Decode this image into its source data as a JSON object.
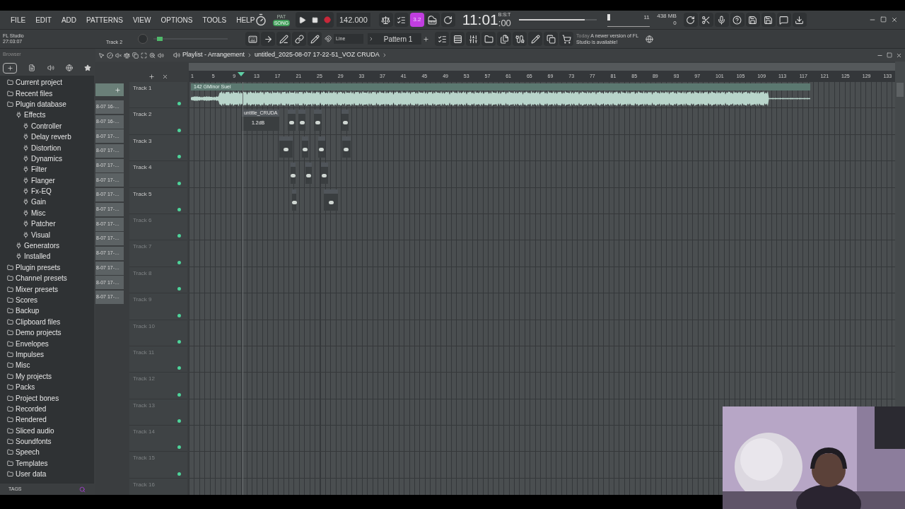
{
  "menu": [
    "FILE",
    "EDIT",
    "ADD",
    "PATTERNS",
    "VIEW",
    "OPTIONS",
    "TOOLS",
    "HELP"
  ],
  "transport": {
    "modes": [
      {
        "label": "PAT",
        "selected": false
      },
      {
        "label": "SONG",
        "selected": true
      }
    ],
    "tempo": "142.000",
    "step": "3.2"
  },
  "clock": {
    "time": "11:01",
    "sub": ":00",
    "unit": "B:S:T"
  },
  "master_volume": {
    "level": 0.85
  },
  "pitch": {
    "level": 0.05
  },
  "monitor": {
    "voices": "11",
    "memory": "438 MB",
    "cpu": "0"
  },
  "hint": {
    "app": "FL Studio",
    "time": "27:03:07",
    "target": "Track 2"
  },
  "snap": "Line",
  "pattern": "Pattern 1",
  "news": {
    "when": "Today",
    "text": "A newer version of FL Studio is available!"
  },
  "browser": {
    "title": "Browser",
    "footer": "TAGS",
    "items": [
      {
        "label": "Current project"
      },
      {
        "label": "Recent files"
      },
      {
        "label": "Plugin database",
        "children": [
          {
            "label": "Effects",
            "children": [
              {
                "label": "Controller"
              },
              {
                "label": "Delay reverb"
              },
              {
                "label": "Distortion"
              },
              {
                "label": "Dynamics"
              },
              {
                "label": "Filter"
              },
              {
                "label": "Flanger"
              },
              {
                "label": "Fx-EQ"
              },
              {
                "label": "Gain"
              },
              {
                "label": "Misc"
              },
              {
                "label": "Patcher"
              },
              {
                "label": "Visual"
              }
            ]
          },
          {
            "label": "Generators"
          },
          {
            "label": "Installed"
          }
        ]
      },
      {
        "label": "Plugin presets"
      },
      {
        "label": "Channel presets"
      },
      {
        "label": "Mixer presets"
      },
      {
        "label": "Scores"
      },
      {
        "label": "Backup"
      },
      {
        "label": "Clipboard files"
      },
      {
        "label": "Demo projects"
      },
      {
        "label": "Envelopes"
      },
      {
        "label": "Impulses"
      },
      {
        "label": "Misc"
      },
      {
        "label": "My projects"
      },
      {
        "label": "Packs"
      },
      {
        "label": "Project bones"
      },
      {
        "label": "Recorded"
      },
      {
        "label": "Rendered"
      },
      {
        "label": "Sliced audio"
      },
      {
        "label": "Soundfonts"
      },
      {
        "label": "Speech"
      },
      {
        "label": "Templates"
      },
      {
        "label": "User data"
      }
    ]
  },
  "picker": {
    "clips": [
      "8-07 16-…",
      "8-07 16-…",
      "8-07 17-…",
      "8-07 17-…",
      "8-07 17-…",
      "8-07 17-…",
      "8-07 17-…",
      "8-07 17-…",
      "8-07 17-…",
      "8-07 17-…",
      "8-07 17-…",
      "8-07 17-…",
      "8-07 17-…",
      "8-07 17-…"
    ]
  },
  "playlist": {
    "title": "Playlist - Arrangement",
    "file": "untitled_2025-08-07 17-22-51_VOZ CRUDA",
    "ruler": [
      "1",
      "5",
      "9",
      "13",
      "17",
      "21",
      "25",
      "29",
      "33",
      "37",
      "41",
      "45",
      "49",
      "53",
      "57",
      "61",
      "65",
      "69",
      "73",
      "77",
      "81",
      "85",
      "89",
      "93",
      "97",
      "101",
      "105",
      "109",
      "113",
      "117",
      "121",
      "125",
      "129",
      "133"
    ],
    "tracks": [
      {
        "name": "Track 1",
        "dimmed": false,
        "clips": [
          {
            "label": "142 GMinor Suei"
          }
        ]
      },
      {
        "name": "Track 2",
        "dimmed": false,
        "clips": [
          {
            "label": "untitle_CRUDA",
            "gain": "1.2dB"
          }
        ]
      },
      {
        "name": "Track 3",
        "dimmed": false
      },
      {
        "name": "Track 4",
        "dimmed": false
      },
      {
        "name": "Track 5",
        "dimmed": false
      },
      {
        "name": "Track 6",
        "dimmed": true
      },
      {
        "name": "Track 7",
        "dimmed": true
      },
      {
        "name": "Track 8",
        "dimmed": true
      },
      {
        "name": "Track 9",
        "dimmed": true
      },
      {
        "name": "Track 10",
        "dimmed": true
      },
      {
        "name": "Track 11",
        "dimmed": true
      },
      {
        "name": "Track 12",
        "dimmed": true
      },
      {
        "name": "Track 13",
        "dimmed": true
      },
      {
        "name": "Track 14",
        "dimmed": true
      },
      {
        "name": "Track 15",
        "dimmed": true
      },
      {
        "name": "Track 16",
        "dimmed": true
      }
    ]
  }
}
